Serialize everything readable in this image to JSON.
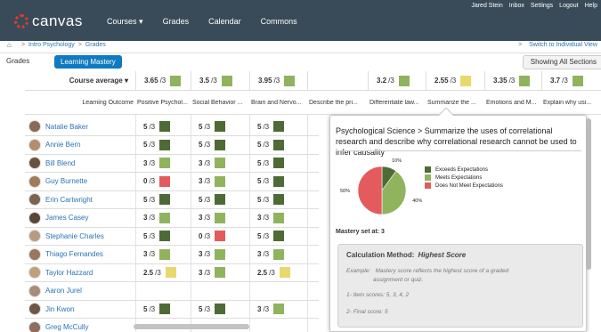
{
  "header": {
    "logo_text": "canvas",
    "nav": [
      "Courses",
      "Grades",
      "Calendar",
      "Commons"
    ],
    "courses_caret": "▾",
    "user_links": [
      "Jared Stein",
      "Inbox",
      "Settings",
      "Logout",
      "Help"
    ]
  },
  "breadcrumb": {
    "home_icon": "⌂",
    "items": [
      "Intro Psychology",
      "Grades"
    ],
    "switch_link": "Switch to Individual View"
  },
  "tabs": {
    "grades": "Grades",
    "learning_mastery": "Learning Mastery",
    "sections_button": "Showing All Sections"
  },
  "colors": {
    "exceeds": "#4e6b35",
    "meets": "#90b35e",
    "near": "#e8d86d",
    "does_not_meet": "#e35b5d",
    "link": "#2a73b6",
    "accent": "#0f7ac1"
  },
  "grid": {
    "course_average_label": "Course average",
    "course_average_caret": "▾",
    "learning_outcome_label": "Learning Outcome",
    "outcomes": [
      "Positive Psychol...",
      "Social Behavior ...",
      "Brain and Nervo...",
      "Describe the pri...",
      "Differentiate law...",
      "Summarize the ...",
      "Emotions and M...",
      "Explain why usi..."
    ],
    "averages": [
      {
        "score": "3.65",
        "max": "/3",
        "status": "meets"
      },
      {
        "score": "3.5",
        "max": "/3",
        "status": "meets"
      },
      {
        "score": "3.95",
        "max": "/3",
        "status": "meets"
      },
      {
        "score": "",
        "max": "",
        "status": ""
      },
      {
        "score": "3.2",
        "max": "/3",
        "status": "meets"
      },
      {
        "score": "2.55",
        "max": "/3",
        "status": "near"
      },
      {
        "score": "3.35",
        "max": "/3",
        "status": "meets"
      },
      {
        "score": "3.7",
        "max": "/3",
        "status": "meets"
      }
    ],
    "students": [
      {
        "name": "Natalie Baker",
        "scores": [
          {
            "v": "5",
            "m": "/3",
            "s": "exceeds"
          },
          {
            "v": "5",
            "m": "/3",
            "s": "exceeds"
          },
          {
            "v": "5",
            "m": "/3",
            "s": "exceeds"
          }
        ]
      },
      {
        "name": "Annie Bern",
        "scores": [
          {
            "v": "5",
            "m": "/3",
            "s": "exceeds"
          },
          {
            "v": "5",
            "m": "/3",
            "s": "exceeds"
          },
          {
            "v": "5",
            "m": "/3",
            "s": "exceeds"
          }
        ]
      },
      {
        "name": "Bill Blend",
        "scores": [
          {
            "v": "3",
            "m": "/3",
            "s": "meets"
          },
          {
            "v": "3",
            "m": "/3",
            "s": "meets"
          },
          {
            "v": "5",
            "m": "/3",
            "s": "exceeds"
          }
        ]
      },
      {
        "name": "Guy Burnette",
        "scores": [
          {
            "v": "0",
            "m": "/3",
            "s": "does_not_meet"
          },
          {
            "v": "3",
            "m": "/3",
            "s": "meets"
          },
          {
            "v": "5",
            "m": "/3",
            "s": "exceeds"
          }
        ]
      },
      {
        "name": "Erin Cartwright",
        "scores": [
          {
            "v": "5",
            "m": "/3",
            "s": "exceeds"
          },
          {
            "v": "5",
            "m": "/3",
            "s": "exceeds"
          },
          {
            "v": "5",
            "m": "/3",
            "s": "exceeds"
          }
        ]
      },
      {
        "name": "James Casey",
        "scores": [
          {
            "v": "3",
            "m": "/3",
            "s": "meets"
          },
          {
            "v": "3",
            "m": "/3",
            "s": "meets"
          },
          {
            "v": "3",
            "m": "/3",
            "s": "meets"
          }
        ]
      },
      {
        "name": "Stephanie Charles",
        "scores": [
          {
            "v": "5",
            "m": "/3",
            "s": "exceeds"
          },
          {
            "v": "0",
            "m": "/3",
            "s": "does_not_meet"
          },
          {
            "v": "5",
            "m": "/3",
            "s": "exceeds"
          }
        ]
      },
      {
        "name": "Thiago Fernandes",
        "scores": [
          {
            "v": "3",
            "m": "/3",
            "s": "meets"
          },
          {
            "v": "3",
            "m": "/3",
            "s": "meets"
          },
          {
            "v": "3",
            "m": "/3",
            "s": "meets"
          }
        ]
      },
      {
        "name": "Taylor Hazzard",
        "scores": [
          {
            "v": "2.5",
            "m": "/3",
            "s": "near"
          },
          {
            "v": "3",
            "m": "/3",
            "s": "meets"
          },
          {
            "v": "2.5",
            "m": "/3",
            "s": "near"
          }
        ]
      },
      {
        "name": "Aaron Jurel",
        "scores": []
      },
      {
        "name": "Jin Kwon",
        "scores": [
          {
            "v": "5",
            "m": "/3",
            "s": "exceeds"
          },
          {
            "v": "5",
            "m": "/3",
            "s": "exceeds"
          },
          {
            "v": "3",
            "m": "/3",
            "s": "meets"
          }
        ]
      },
      {
        "name": "Greg McCully",
        "scores": []
      }
    ]
  },
  "popover": {
    "title": "Psychological Science > Summarize the uses of correlational research and describe why correlational research cannot be used to infer causality",
    "pie_labels": {
      "exceeds": "10%",
      "meets": "40%",
      "does_not_meet": "50%"
    },
    "legend": [
      {
        "label": "Exceeds Expectations",
        "status": "exceeds"
      },
      {
        "label": "Meets Expectations",
        "status": "meets"
      },
      {
        "label": "Does Not Meet Expectations",
        "status": "does_not_meet"
      }
    ],
    "mastery": "Mastery set at: 3",
    "calc_label": "Calculation Method:",
    "calc_method": "Highest Score",
    "example_prefix": "Example:",
    "example_line1": "Mastery score reflects the highest score of a graded",
    "example_line2": "assignment or quiz.",
    "item_scores": "1- Item scores:  5, 3, 4, 2",
    "final_score": "2- Final score:  5"
  },
  "chart_data": {
    "type": "pie",
    "title": "",
    "categories": [
      "Exceeds Expectations",
      "Meets Expectations",
      "Does Not Meet Expectations"
    ],
    "values": [
      10,
      40,
      50
    ],
    "unit": "%"
  }
}
